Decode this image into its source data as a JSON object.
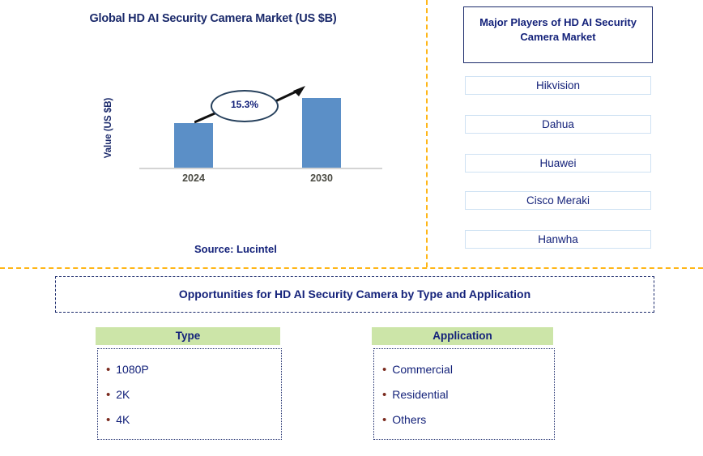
{
  "chart_panel": {
    "title": "Global HD AI Security Camera Market (US $B)",
    "source": "Source: Lucintel"
  },
  "chart_data": {
    "type": "bar",
    "title": "Global HD AI Security Camera Market (US $B)",
    "categories": [
      "2024",
      "2030"
    ],
    "values": [
      55,
      86
    ],
    "xlabel": "",
    "ylabel": "Value (US $B)",
    "grid": false,
    "legend": "none",
    "bar_color": "#5b8fc7",
    "annotations": [
      {
        "label": "15.3%",
        "type": "cagr-callout",
        "from": "2024",
        "to": "2030"
      }
    ]
  },
  "players": {
    "header": "Major Players of HD AI Security Camera Market",
    "items": [
      {
        "label": "Hikvision"
      },
      {
        "label": "Dahua"
      },
      {
        "label": "Huawei"
      },
      {
        "label": "Cisco Meraki"
      },
      {
        "label": "Hanwha"
      }
    ]
  },
  "opportunities": {
    "banner": "Opportunities for HD AI Security Camera by Type and Application",
    "columns": [
      {
        "header": "Type",
        "items": [
          "1080P",
          "2K",
          "4K"
        ]
      },
      {
        "header": "Application",
        "items": [
          "Commercial",
          "Residential",
          "Others"
        ]
      }
    ]
  },
  "bullet_glyph": "•",
  "colors": {
    "navy_text": "#14227a",
    "bar_blue": "#5b8fc7",
    "divider_orange": "#ffb617",
    "header_green": "#cce5a8",
    "bullet_maroon": "#7b2b1f"
  }
}
